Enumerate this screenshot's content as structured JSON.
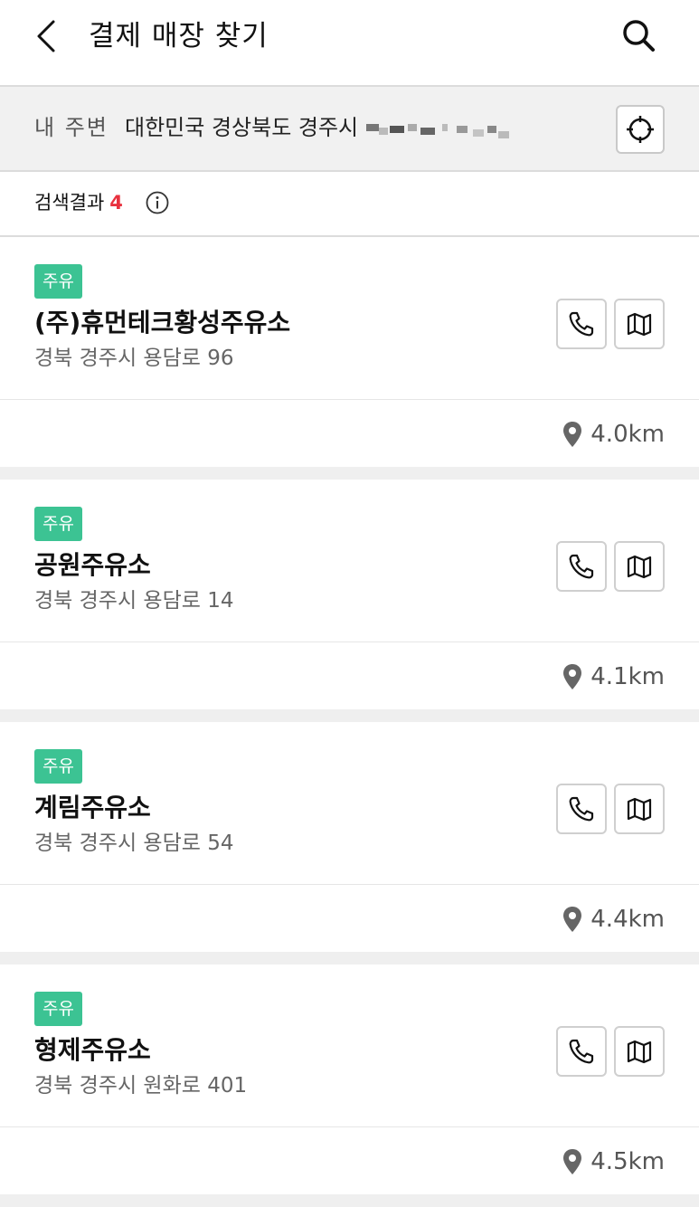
{
  "header": {
    "title": "결제 매장 찾기",
    "back_icon": "chevron-left-icon",
    "search_icon": "search-icon"
  },
  "location": {
    "label": "내 주변",
    "address": "대한민국 경상북도 경주시",
    "gps_icon": "crosshair-icon"
  },
  "results": {
    "label": "검색결과",
    "count": "4",
    "info_icon": "info-icon"
  },
  "colors": {
    "badge": "#3cc393",
    "count": "#e8323f",
    "location_bar": "#f1f1f1"
  },
  "stations": [
    {
      "badge": "주유",
      "name": "(주)휴먼테크황성주유소",
      "address": "경북 경주시 용담로 96",
      "distance": "4.0km"
    },
    {
      "badge": "주유",
      "name": "공원주유소",
      "address": "경북 경주시 용담로 14",
      "distance": "4.1km"
    },
    {
      "badge": "주유",
      "name": "계림주유소",
      "address": "경북 경주시 용담로 54",
      "distance": "4.4km"
    },
    {
      "badge": "주유",
      "name": "형제주유소",
      "address": "경북 경주시 원화로 401",
      "distance": "4.5km"
    }
  ]
}
